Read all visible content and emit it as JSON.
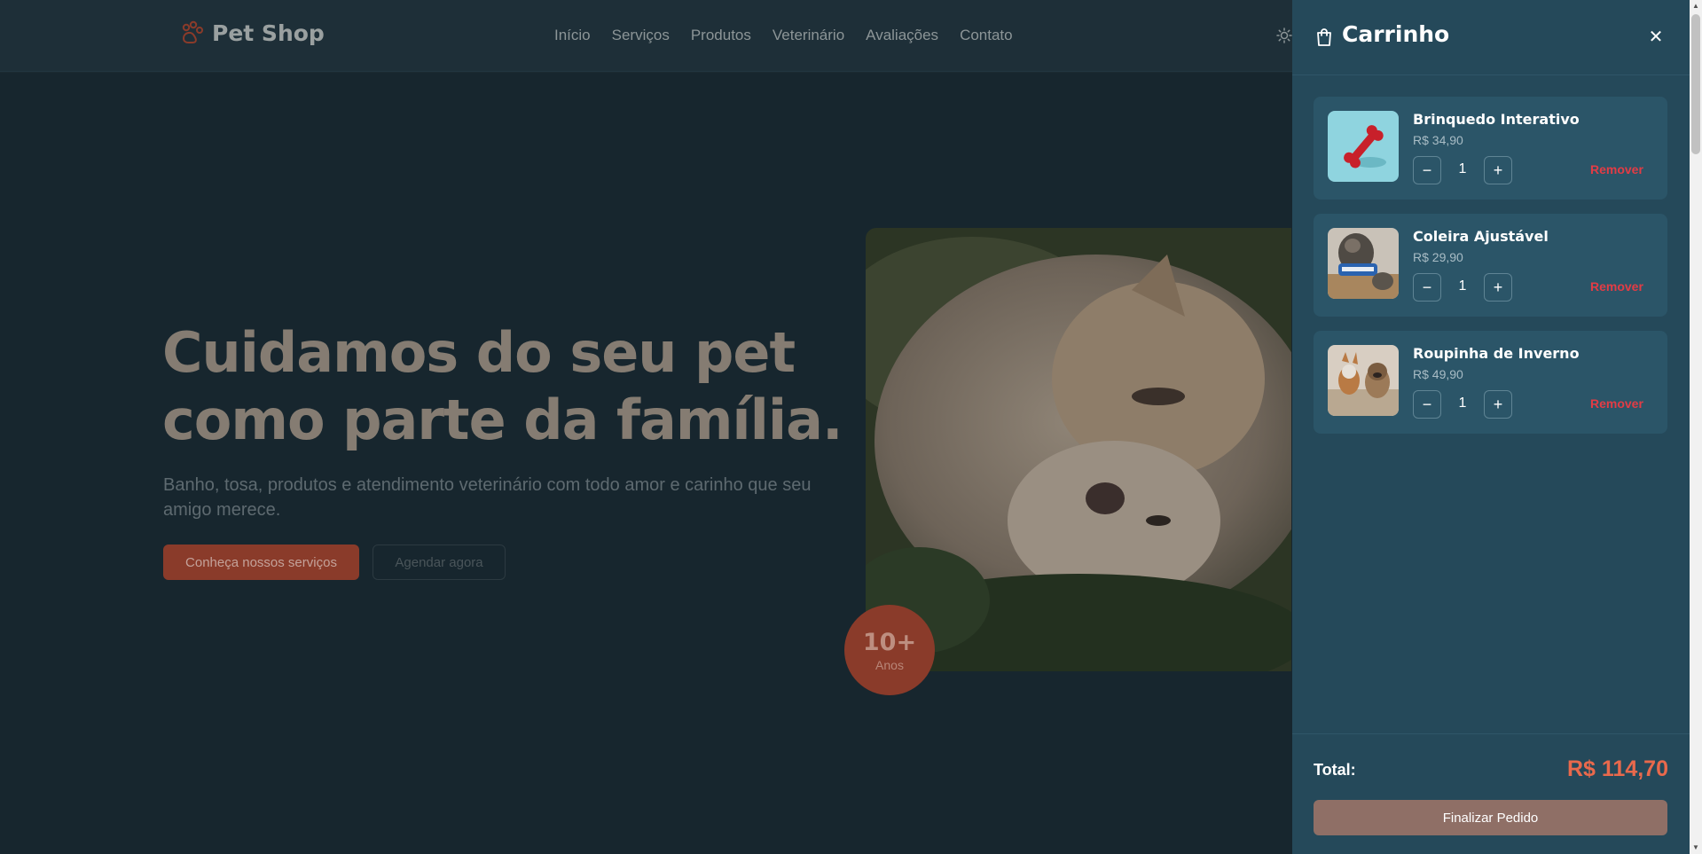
{
  "brand": {
    "name": "Pet Shop",
    "accent": "#e9694c"
  },
  "nav": {
    "items": [
      "Início",
      "Serviços",
      "Produtos",
      "Veterinário",
      "Avaliações",
      "Contato"
    ]
  },
  "hero": {
    "title": "Cuidamos do seu pet como parte da família.",
    "subtitle": "Banho, tosa, produtos e atendimento veterinário com todo amor e carinho que seu amigo merece.",
    "primary_button": "Conheça nossos serviços",
    "secondary_button": "Agendar agora",
    "badge": {
      "value": "10+",
      "label": "Anos"
    }
  },
  "cart": {
    "title": "Carrinho",
    "close_icon": "close-icon",
    "items": [
      {
        "name": "Brinquedo Interativo",
        "price": "R$ 34,90",
        "quantity": "1",
        "remove_label": "Remover",
        "image": "bone-toy"
      },
      {
        "name": "Coleira Ajustável",
        "price": "R$ 29,90",
        "quantity": "1",
        "remove_label": "Remover",
        "image": "dog-collar"
      },
      {
        "name": "Roupinha de Inverno",
        "price": "R$ 49,90",
        "quantity": "1",
        "remove_label": "Remover",
        "image": "dogs-clothes"
      }
    ],
    "total_label": "Total:",
    "total_value": "R$ 114,70",
    "checkout_label": "Finalizar Pedido",
    "minus": "−",
    "plus": "+"
  }
}
